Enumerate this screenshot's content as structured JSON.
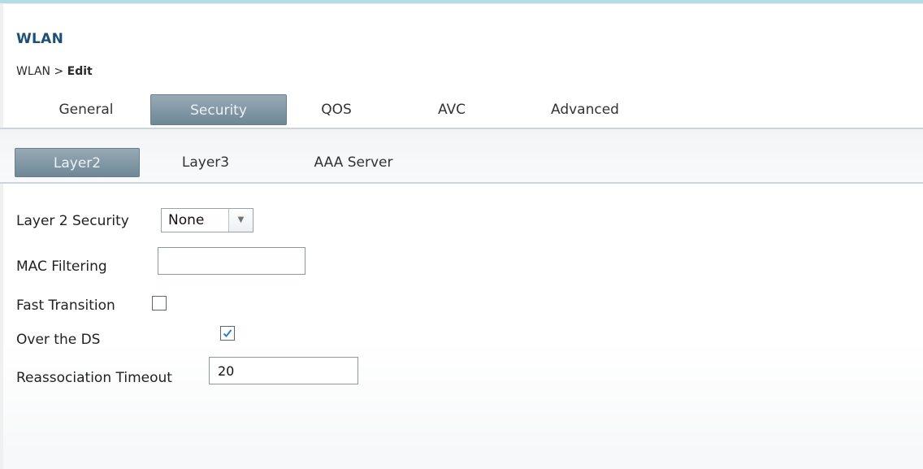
{
  "page": {
    "title": "WLAN",
    "breadcrumb": {
      "root": "WLAN",
      "separator": ">",
      "current": "Edit"
    }
  },
  "tabs": [
    {
      "label": "General",
      "active": false
    },
    {
      "label": "Security",
      "active": true
    },
    {
      "label": "QOS",
      "active": false
    },
    {
      "label": "AVC",
      "active": false
    },
    {
      "label": "Advanced",
      "active": false
    }
  ],
  "subtabs": [
    {
      "label": "Layer2",
      "active": true
    },
    {
      "label": "Layer3",
      "active": false
    },
    {
      "label": "AAA Server",
      "active": false
    }
  ],
  "form": {
    "layer2_security": {
      "label": "Layer 2 Security",
      "selected": "None",
      "arrow_icon": "chevron-down-icon"
    },
    "mac_filtering": {
      "label": "MAC Filtering",
      "value": ""
    },
    "fast_transition": {
      "label": "Fast Transition",
      "checked": false
    },
    "over_the_ds": {
      "label": "Over the DS",
      "checked": true
    },
    "reassociation_timeout": {
      "label": "Reassociation Timeout",
      "value": "20"
    }
  },
  "colors": {
    "title": "#1d4f78",
    "tab_active_top": "#97aab5",
    "tab_active_bottom": "#6f8796",
    "top_bar": "#b6dbe6",
    "checkmark": "#2f7fd0"
  }
}
